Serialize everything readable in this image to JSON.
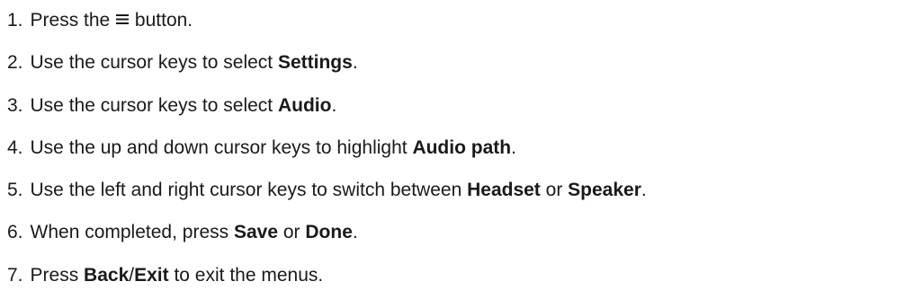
{
  "steps": [
    {
      "number": "1.",
      "prefix": "Press the",
      "icon": "menu-icon",
      "suffix": "button."
    },
    {
      "number": "2.",
      "prefix": "Use the cursor keys to select",
      "bold": "Settings",
      "suffix": "."
    },
    {
      "number": "3.",
      "prefix": "Use the cursor keys to select",
      "bold": "Audio",
      "suffix": "."
    },
    {
      "number": "4.",
      "prefix": "Use the up and down cursor keys to highlight",
      "bold": "Audio path",
      "suffix": "."
    },
    {
      "number": "5.",
      "prefix": "Use the left and right cursor keys to switch between",
      "bold": "Headset",
      "middle": "or",
      "bold2": "Speaker",
      "suffix": "."
    },
    {
      "number": "6.",
      "prefix": "When completed, press",
      "bold": "Save",
      "middle": "or",
      "bold2": "Done",
      "suffix": "."
    },
    {
      "number": "7.",
      "prefix": "Press",
      "bold": "Back",
      "sep": "/",
      "bold2": "Exit",
      "suffix": "to exit the menus."
    }
  ]
}
